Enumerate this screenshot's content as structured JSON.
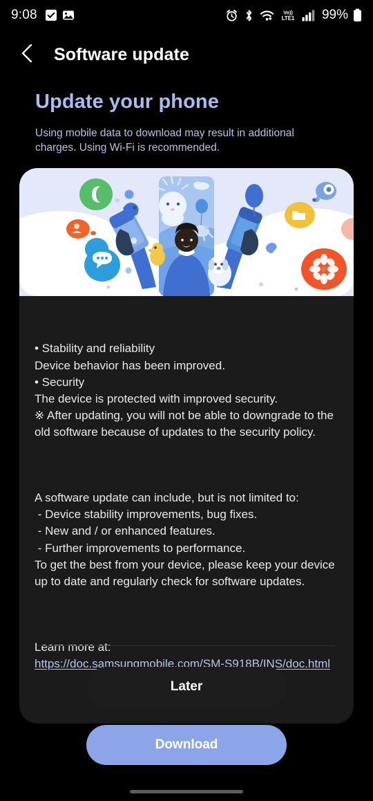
{
  "statusbar": {
    "time": "9:08",
    "left_icons": [
      "checkbox-checked-icon",
      "image-icon"
    ],
    "right_icons": [
      "alarm-icon",
      "bluetooth-icon",
      "wifi-icon",
      "volte-lte1-icon",
      "signal-bars-icon"
    ],
    "volte_label": "Vo))",
    "lte_label": "LTE1",
    "battery_percent": "99%"
  },
  "actionbar": {
    "back_icon": "chevron-left-icon",
    "title": "Software update"
  },
  "header": {
    "title": "Update your phone",
    "subtitle": "Using mobile data to download may result in additional charges. Using Wi-Fi is recommended.",
    "title_color": "#a9bbf0",
    "subtitle_color": "#b7c3e2"
  },
  "illustration": {
    "alt": "person holding phones with app icons floating around",
    "background_color": "#e3e8fb",
    "app_icons": [
      {
        "name": "phone-icon",
        "color": "#58bd6b"
      },
      {
        "name": "contacts-icon",
        "color": "#f0642a"
      },
      {
        "name": "messages-icon",
        "color": "#2e9ddc"
      },
      {
        "name": "camera-icon",
        "color": "#4a7fd4"
      },
      {
        "name": "folder-icon",
        "color": "#f2c13c"
      },
      {
        "name": "gallery-icon",
        "color": "#f0562a"
      }
    ]
  },
  "release_notes": {
    "paragraph_1": "• Stability and reliability\nDevice behavior has been improved.\n• Security\nThe device is protected with improved security.\n※ After updating, you will not be able to downgrade to the old software because of updates to the security policy.",
    "paragraph_2": "A software update can include, but is not limited to:\n - Device stability improvements, bug fixes.\n - New and / or enhanced features.\n - Further improvements to performance.\nTo get the best from your device, please keep your device up to date and regularly check for software updates.",
    "learn_more_label": "Learn more at:",
    "learn_more_url": "https://doc.samsungmobile.com/SM-S918B/INS/doc.html"
  },
  "footer": {
    "later_label": "Later",
    "download_label": "Download",
    "later_bg": "#1d1d1d",
    "download_bg": "#8ca5e8"
  },
  "navbar": {
    "gesture_handle": "home-gesture-bar"
  }
}
